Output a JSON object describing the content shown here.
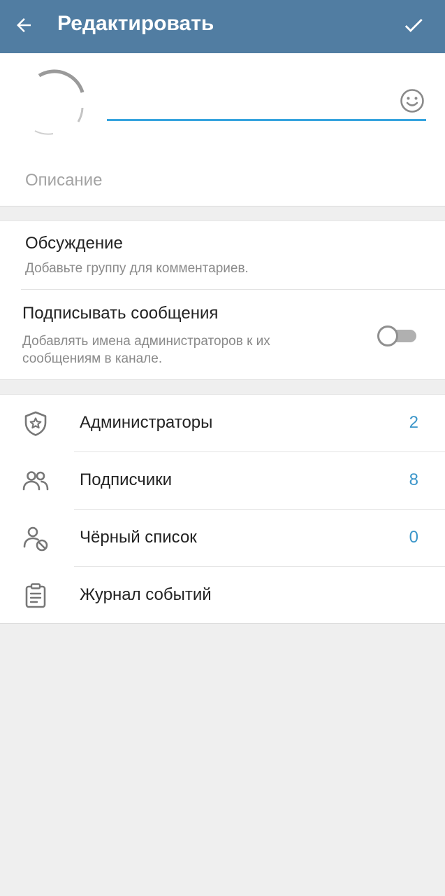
{
  "header": {
    "title": "Редактировать",
    "back_icon": "arrow-left-icon",
    "done_icon": "checkmark-icon",
    "background_color": "#517da2"
  },
  "profile": {
    "name_value": "",
    "description_placeholder": "Описание",
    "emoji_icon": "smile-icon",
    "accent_color": "#37a4de"
  },
  "settings": {
    "discussion": {
      "title": "Обсуждение",
      "subtitle": "Добавьте группу для комментариев."
    },
    "sign_messages": {
      "title": "Подписывать сообщения",
      "subtitle_line1": "Добавлять имена администраторов к их",
      "subtitle_line2": "сообщениям в канале.",
      "enabled": false
    }
  },
  "management": {
    "items": [
      {
        "label": "Администраторы",
        "count": "2",
        "icon": "shield-star-icon"
      },
      {
        "label": "Подписчики",
        "count": "8",
        "icon": "people-icon"
      },
      {
        "label": "Чёрный список",
        "count": "0",
        "icon": "user-blocked-icon"
      },
      {
        "label": "Журнал событий",
        "count": "",
        "icon": "clipboard-icon"
      }
    ],
    "count_color": "#3a95c9"
  }
}
